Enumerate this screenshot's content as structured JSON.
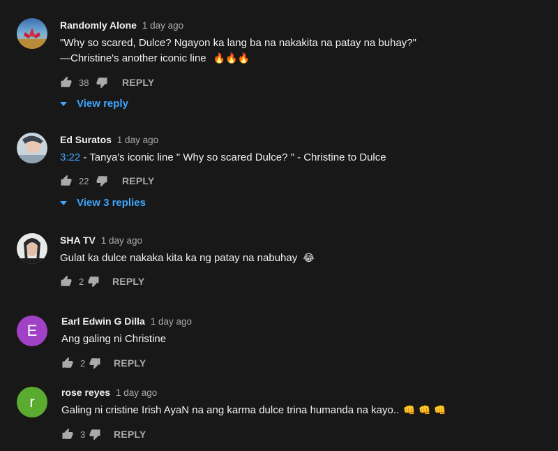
{
  "colors": {
    "background": "#181818",
    "link": "#3ea6ff",
    "secondary_text": "#aaaaaa",
    "avatar_earl": "#a142c6",
    "avatar_rose": "#5aab2f"
  },
  "comments": [
    {
      "author": "Randomly Alone",
      "time": "1 day ago",
      "text_line1": "\"Why so scared, Dulce? Ngayon ka lang ba na nakakita na patay na buhay?\"",
      "text_line2": "—Christine's another iconic line",
      "emoji": "🔥🔥🔥",
      "likes": "38",
      "reply_label": "REPLY",
      "view_replies": "View reply",
      "avatar_icon": "lotus-avatar-icon"
    },
    {
      "author": "Ed Suratos",
      "time": "1 day ago",
      "timestamp_link": "3:22",
      "text": " - Tanya's iconic line \" Why so scared Dulce? \" - Christine to Dulce",
      "likes": "22",
      "reply_label": "REPLY",
      "view_replies": "View 3 replies",
      "avatar_icon": "photo-avatar-icon"
    },
    {
      "author": "SHA TV",
      "time": "1 day ago",
      "text": "Gulat ka dulce nakaka kita ka ng patay na nabuhay",
      "emoji": "😂",
      "likes": "2",
      "reply_label": "REPLY",
      "avatar_icon": "photo-avatar-icon"
    },
    {
      "author": "Earl Edwin G Dilla",
      "time": "1 day ago",
      "avatar_letter": "E",
      "text": "Ang galing ni Christine",
      "likes": "2",
      "reply_label": "REPLY"
    },
    {
      "author": "rose reyes",
      "time": "1 day ago",
      "avatar_letter": "r",
      "text": "Galing ni cristine Irish AyaN na ang karma dulce trina humanda na kayo..",
      "emoji": "👊 👊 👊",
      "likes": "3",
      "reply_label": "REPLY"
    }
  ]
}
